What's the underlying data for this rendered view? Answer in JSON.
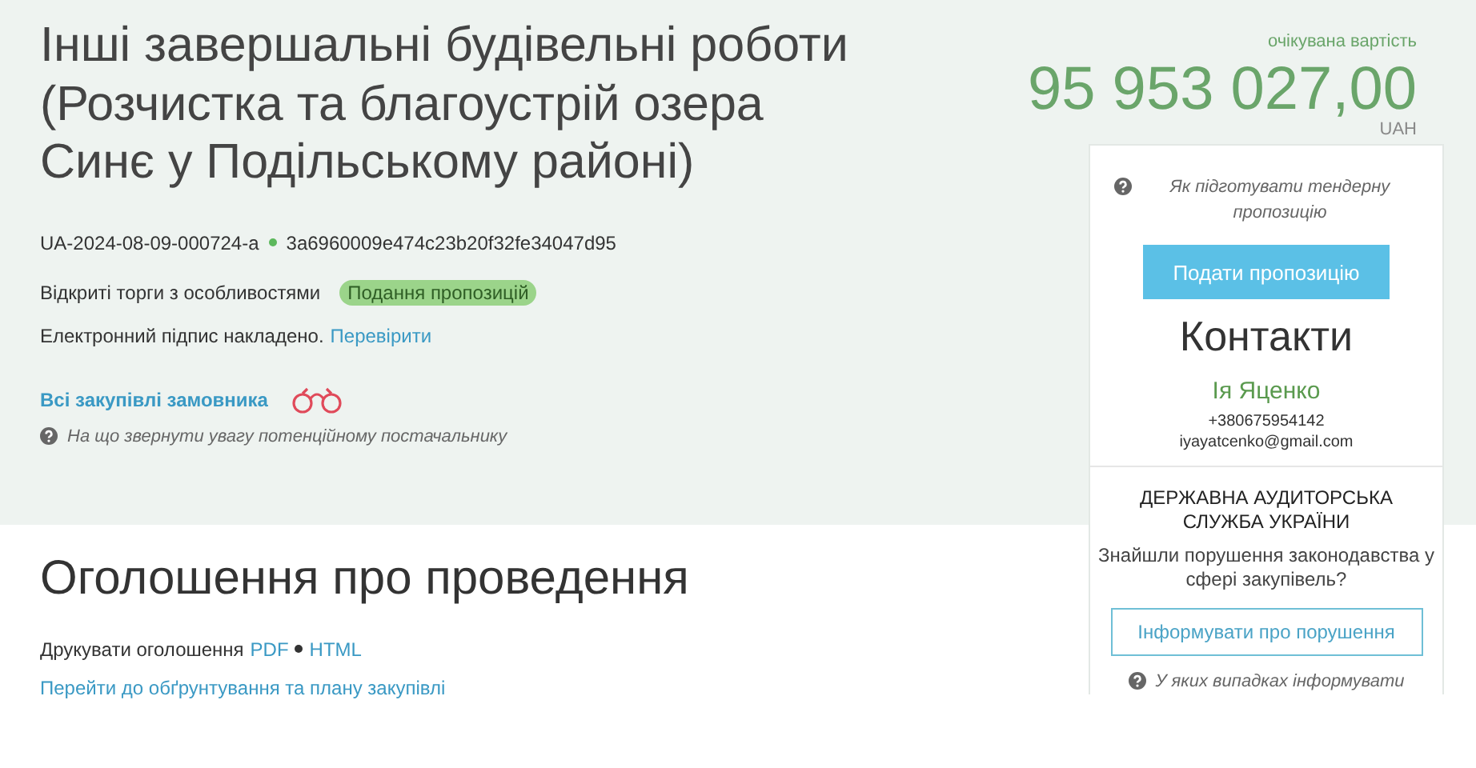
{
  "title": "Інші завершальні будівельні роботи (Розчистка та благоустрій озера Синє у Подільському районі)",
  "expected_value": {
    "label": "очікувана вартість",
    "amount": "95 953 027,00",
    "currency": "UAH"
  },
  "tender_id": "UA-2024-08-09-000724-a",
  "hash": "3a6960009e474c23b20f32fe34047d95",
  "procedure": {
    "type": "Відкриті торги з особливостями",
    "status": "Подання пропозицій"
  },
  "signature": {
    "text": "Електронний підпис накладено.",
    "link": "Перевірити"
  },
  "customer_link": "Всі закупівлі замовника",
  "hint": "На що звернути увагу потенційному постачальнику",
  "announcement": {
    "heading": "Оголошення про проведення",
    "print_label": "Друкувати оголошення",
    "print_links": [
      "PDF",
      "HTML"
    ],
    "plan_link": "Перейти до обґрунтування та плану закупівлі"
  },
  "sidebar": {
    "help": "Як підготувати тендерну пропозицію",
    "submit_button": "Подати пропозицію",
    "contacts_heading": "Контакти",
    "contact": {
      "name": "Ія Яценко",
      "phone": "+380675954142",
      "email": "iyayatcenko@gmail.com"
    },
    "audit": {
      "title": "ДЕРЖАВНА АУДИТОРСЬКА СЛУЖБА УКРАЇНИ",
      "question": "Знайшли порушення законодавства у сфері закупівель?",
      "button": "Інформувати про порушення",
      "help": "У яких випадках інформувати"
    }
  }
}
